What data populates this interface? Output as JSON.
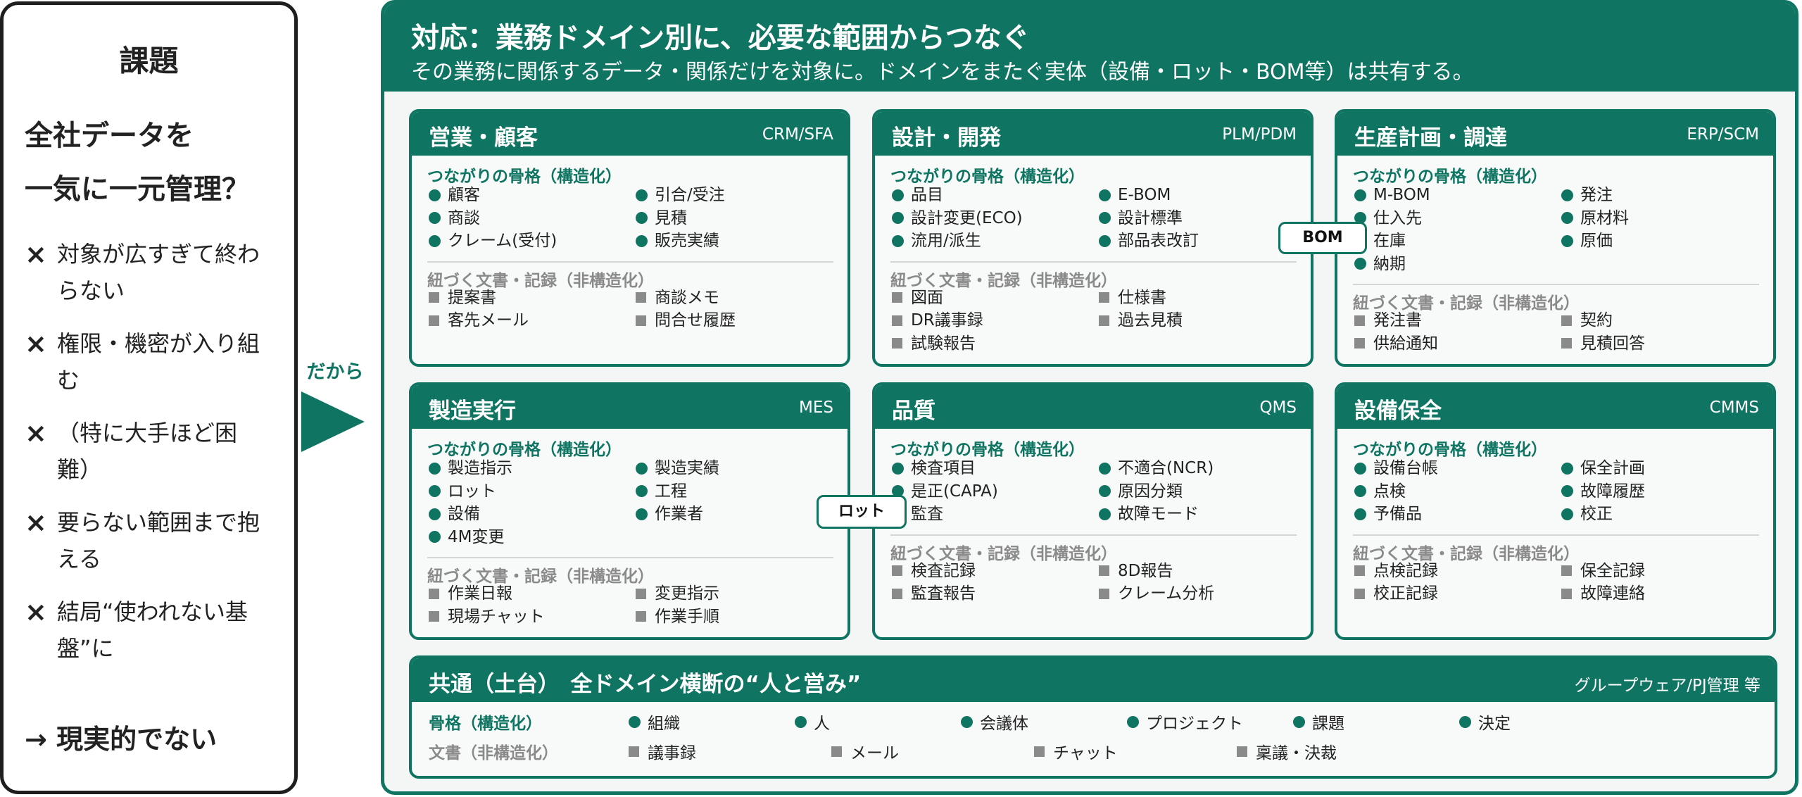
{
  "left": {
    "title": "課題",
    "headline_1": "全社データを",
    "headline_2": "一気に一元管理？",
    "issue_mark": "×",
    "issues": [
      [
        "対象が広すぎて終わ",
        "らない"
      ],
      [
        "権限・機密が入り組",
        "む"
      ],
      [
        "（特に大手ほど困",
        "難）"
      ],
      [
        "要らない範囲まで抱",
        "える"
      ],
      [
        "結局“使われない基",
        "盤”に"
      ]
    ],
    "conclusion": "→ 現実的でない"
  },
  "arrow": {
    "label": "だから"
  },
  "right": {
    "title": "対応：業務ドメイン別に、必要な範囲からつなぐ",
    "subtitle": "その業務に関係するデータ・関係だけを対象に。ドメインをまたぐ実体（設備・ロット・BOM等）は共有する。",
    "struct_heading": "つながりの骨格（構造化）",
    "doc_heading": "紐づく文書・記録（非構造化）"
  },
  "domains": [
    {
      "name": "営業・顧客",
      "tag": "CRM/SFA",
      "structured": [
        "顧客",
        "引合/受注",
        "商談",
        "見積",
        "クレーム(受付)",
        "販売実績"
      ],
      "documents": [
        "提案書",
        "商談メモ",
        "客先メール",
        "問合せ履歴"
      ]
    },
    {
      "name": "設計・開発",
      "tag": "PLM/PDM",
      "structured": [
        "品目",
        "E-BOM",
        "設計変更(ECO)",
        "設計標準",
        "流用/派生",
        "部品表改訂"
      ],
      "documents": [
        "図面",
        "仕様書",
        "DR議事録",
        "過去見積",
        "試験報告"
      ]
    },
    {
      "name": "生産計画・調達",
      "tag": "ERP/SCM",
      "structured": [
        "M-BOM",
        "発注",
        "仕入先",
        "原材料",
        "在庫",
        "原価",
        "納期"
      ],
      "documents": [
        "発注書",
        "契約",
        "供給通知",
        "見積回答"
      ]
    },
    {
      "name": "製造実行",
      "tag": "MES",
      "structured": [
        "製造指示",
        "製造実績",
        "ロット",
        "工程",
        "設備",
        "作業者",
        "4M変更"
      ],
      "documents": [
        "作業日報",
        "変更指示",
        "現場チャット",
        "作業手順"
      ]
    },
    {
      "name": "品質",
      "tag": "QMS",
      "structured": [
        "検査項目",
        "不適合(NCR)",
        "是正(CAPA)",
        "原因分類",
        "監査",
        "故障モード"
      ],
      "documents": [
        "検査記録",
        "8D報告",
        "監査報告",
        "クレーム分析"
      ]
    },
    {
      "name": "設備保全",
      "tag": "CMMS",
      "structured": [
        "設備台帳",
        "保全計画",
        "点検",
        "故障履歴",
        "予備品",
        "校正"
      ],
      "documents": [
        "点検記録",
        "保全記録",
        "校正記録",
        "故障連絡"
      ]
    }
  ],
  "common": {
    "name": "共通（土台）　全ドメイン横断の“人と営み”",
    "tag": "グループウェア/PJ管理 等",
    "struct_label": "骨格（構造化）",
    "doc_label": "文書（非構造化）",
    "structured": [
      "組織",
      "人",
      "会議体",
      "プロジェクト",
      "課題",
      "決定"
    ],
    "documents": [
      "議事録",
      "メール",
      "チャット",
      "稟議・決裁"
    ]
  },
  "badges": {
    "bom": "BOM",
    "lot": "ロット"
  },
  "colors": {
    "accent": "#0f7562",
    "doc_gray": "#8a8a8a"
  }
}
